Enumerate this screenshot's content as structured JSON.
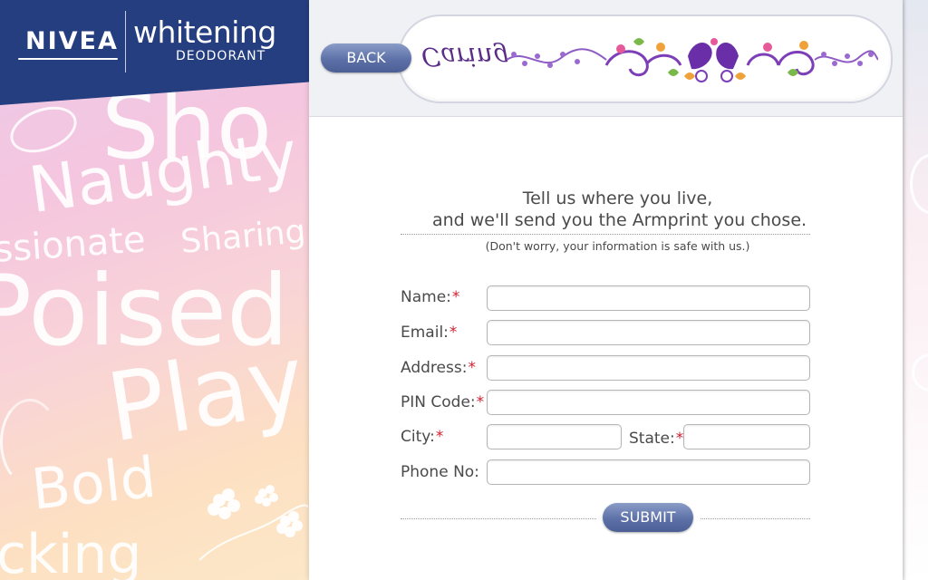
{
  "brand": {
    "logo_text": "NIVEA",
    "product_name": "whitening",
    "product_sub": "DEODORANT"
  },
  "background_words": [
    "Sho",
    "Naughty",
    "ssionate",
    "Sharing",
    "Poised",
    "Play",
    "Bold",
    "cking"
  ],
  "header": {
    "back_label": "BACK",
    "banner_text": "Caring"
  },
  "form": {
    "heading_line1": "Tell us where you live,",
    "heading_line2": "and we'll send you the Armprint you chose.",
    "note": "(Don't worry, your information is safe with us.)",
    "required_mark": "*",
    "fields": {
      "name": {
        "label": "Name:",
        "value": ""
      },
      "email": {
        "label": "Email:",
        "value": ""
      },
      "address": {
        "label": "Address:",
        "value": ""
      },
      "pin": {
        "label": "PIN Code:",
        "value": ""
      },
      "city": {
        "label": "City:",
        "value": ""
      },
      "state": {
        "label": "State:",
        "value": ""
      },
      "phone": {
        "label": "Phone No:",
        "value": ""
      }
    },
    "submit_label": "SUBMIT"
  },
  "colors": {
    "brand_blue": "#243e80",
    "button_blue": "#5d71a8",
    "required_red": "#d21f2f",
    "banner_purple": "#5b2d87"
  }
}
